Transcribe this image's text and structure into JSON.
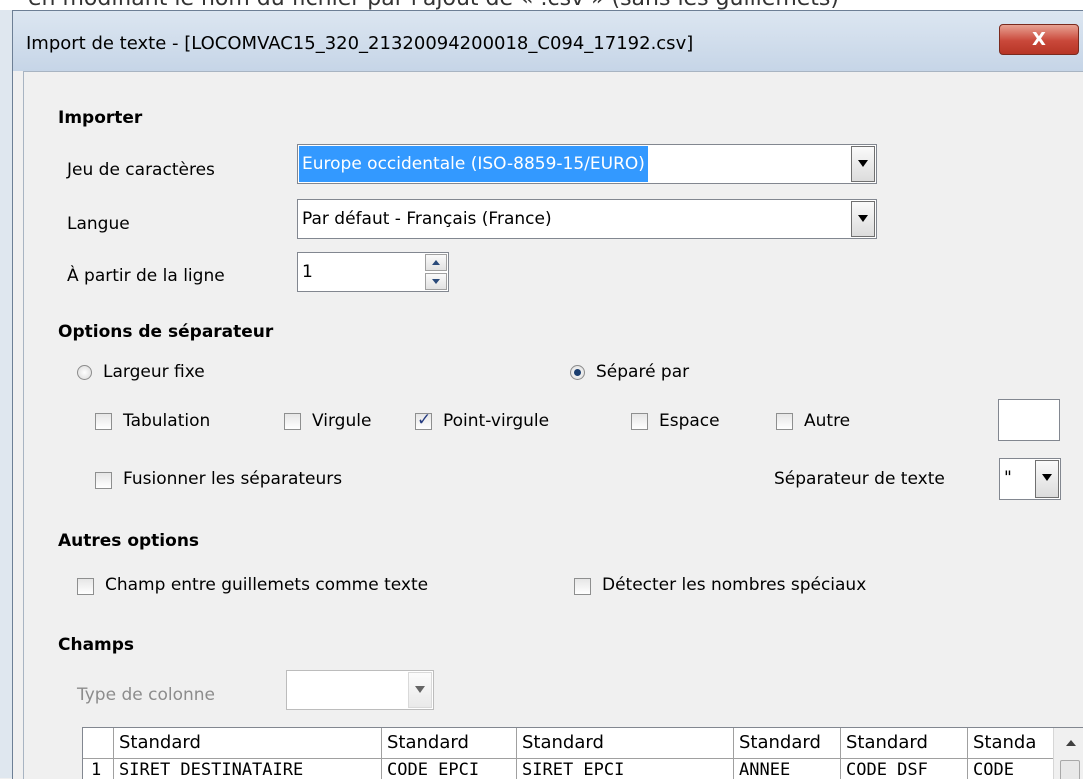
{
  "background_text": "en modifiant le nom du fichier par l'ajout de « .csv » (sans les guillemets)",
  "window": {
    "title": "Import de texte - [LOCOMVAC15_320_21320094200018_C094_17192.csv]",
    "close_label": "X"
  },
  "import": {
    "heading": "Importer",
    "charset_label": "Jeu de caractères",
    "charset_value": "Europe occidentale (ISO-8859-15/EURO)",
    "language_label": "Langue",
    "language_value": "Par défaut - Français (France)",
    "from_row_label": "À partir de la ligne",
    "from_row_value": "1"
  },
  "separator": {
    "heading": "Options de séparateur",
    "fixed_width_label": "Largeur fixe",
    "separated_by_label": "Séparé par",
    "selected_mode": "Séparé par",
    "tab_label": "Tabulation",
    "comma_label": "Virgule",
    "semicolon_label": "Point-virgule",
    "space_label": "Espace",
    "other_label": "Autre",
    "other_value": "",
    "merge_label": "Fusionner les séparateurs",
    "text_sep_label": "Séparateur de texte",
    "text_sep_value": "\"",
    "checked": [
      "Point-virgule"
    ]
  },
  "other_options": {
    "heading": "Autres options",
    "quoted_as_text_label": "Champ entre guillemets comme texte",
    "detect_special_label": "Détecter les nombres spéciaux"
  },
  "fields": {
    "heading": "Champs",
    "column_type_label": "Type de colonne",
    "column_type_value": "",
    "headers": [
      "Standard",
      "Standard",
      "Standard",
      "Standard",
      "Standard",
      "Standa"
    ],
    "rows": [
      {
        "num": "1",
        "cells": [
          "SIRET DESTINATAIRE",
          "CODE EPCI",
          "SIRET EPCI",
          "ANNEE",
          "CODE DSF",
          "CODE"
        ]
      }
    ]
  },
  "colors": {
    "selection": "#3399ff",
    "close_button": "#c9483a",
    "titlebar": "#c6d5e7"
  }
}
